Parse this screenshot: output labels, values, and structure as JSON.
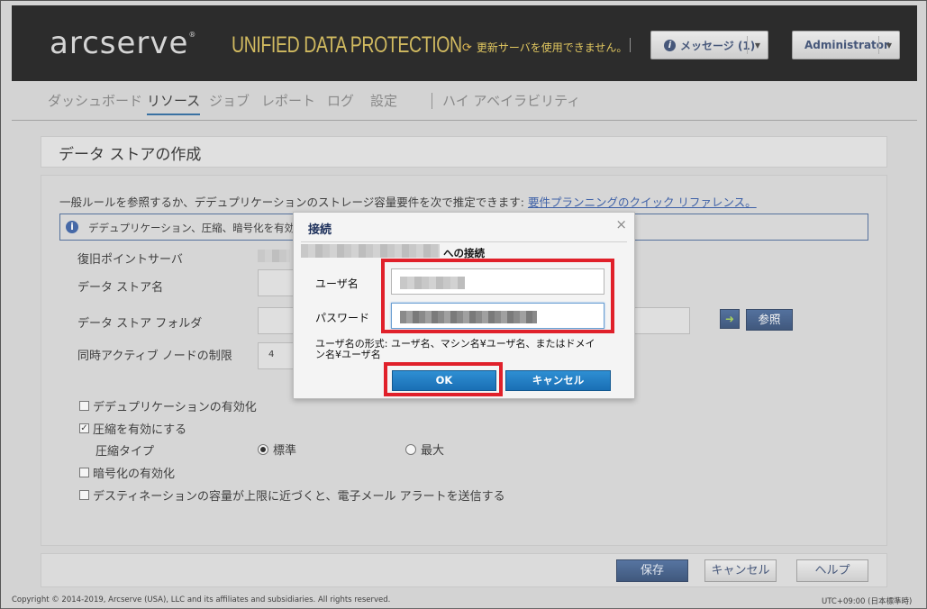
{
  "header": {
    "logo": "arcserve",
    "logo_mark": "®",
    "product": "UNIFIED DATA PROTECTION",
    "notice_text": "更新サーバを使用できません。",
    "messages_label": "メッセージ (1)",
    "user_label": "Administrator"
  },
  "nav": {
    "items": [
      "ダッシュボード",
      "リソース",
      "ジョブ",
      "レポート",
      "ログ",
      "設定",
      "ハイ アベイラビリティ"
    ],
    "active": "リソース"
  },
  "page": {
    "title": "データ ストアの作成",
    "intro_text": "一般ルールを参照するか、デデュプリケーションのストレージ容量要件を次で推定できます: ",
    "intro_link": "要件プランニングのクイック リファレンス。",
    "info_text": "デデュプリケーション、圧縮、暗号化を有効化また"
  },
  "form": {
    "rps_label": "復旧ポイントサーバ",
    "name_label": "データ ストア名",
    "folder_label": "データ ストア フォルダ",
    "concurrent_label": "同時アクティブ ノードの制限",
    "concurrent_value": "4",
    "browse_label": "参照",
    "dedup_label": "デデュプリケーションの有効化",
    "compress_label": "圧縮を有効にする",
    "compress_type_label": "圧縮タイプ",
    "standard_label": "標準",
    "max_label": "最大",
    "encrypt_label": "暗号化の有効化",
    "alert_label": "デスティネーションの容量が上限に近づくと、電子メール アラートを送信する"
  },
  "footer": {
    "save_label": "保存",
    "cancel_label": "キャンセル",
    "help_label": "ヘルプ",
    "copyright": "Copyright © 2014-2019, Arcserve (USA), LLC and its affiliates and subsidiaries. All rights reserved.",
    "timezone": "UTC+09:00 (日本標準時)"
  },
  "dialog": {
    "title": "接続",
    "close": "×",
    "connect_to": "への接続",
    "username_label": "ユーザ名",
    "password_label": "パスワード",
    "hint": "ユーザ名の形式: ユーザ名、マシン名¥ユーザ名、またはドメイン名¥ユーザ名",
    "ok_label": "OK",
    "cancel_label": "キャンセル"
  },
  "colors": {
    "accent": "#1a6fb5",
    "highlight": "#e0202a",
    "header_bg": "#0a0a0a",
    "product": "#d4b84a"
  }
}
